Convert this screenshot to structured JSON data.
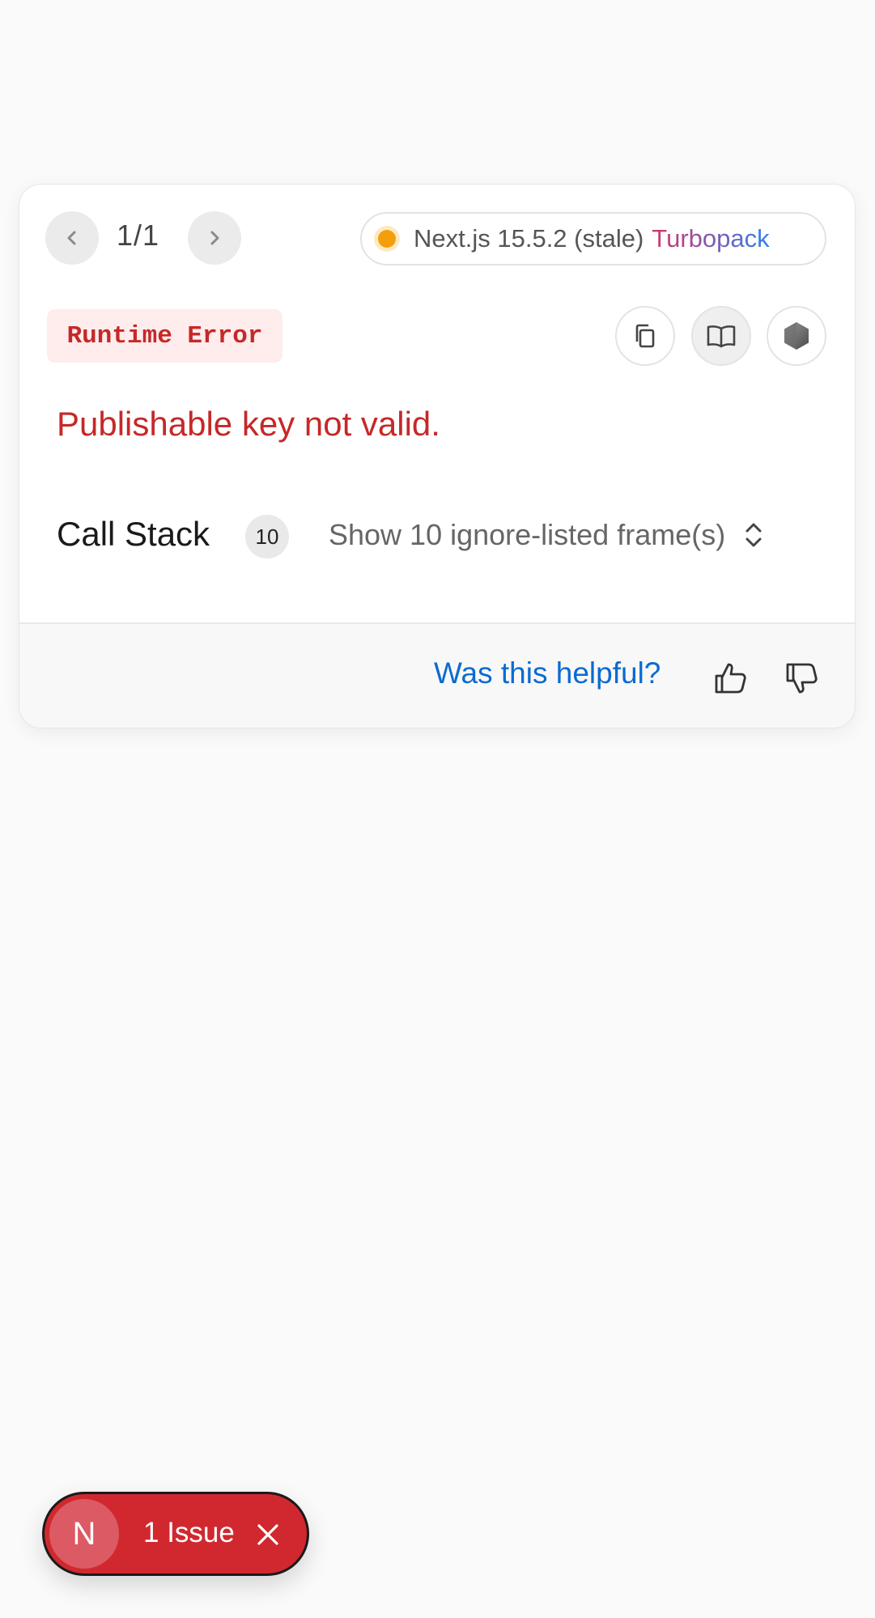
{
  "pager": {
    "text": "1/1"
  },
  "version": {
    "label": "Next.js 15.5.2 (stale)",
    "bundler": "Turbopack",
    "status_color": "#f59e0b"
  },
  "error": {
    "badge": "Runtime Error",
    "message": "Publishable key not valid."
  },
  "call_stack": {
    "title": "Call Stack",
    "count": "10",
    "toggle_label": "Show 10 ignore-listed frame(s)"
  },
  "feedback": {
    "question": "Was this helpful?"
  },
  "issues": {
    "logo_letter": "N",
    "label": "1 Issue"
  },
  "icons": [
    "chevron-left-icon",
    "chevron-right-icon",
    "copy-icon",
    "book-icon",
    "node-icon",
    "chevron-updown-icon",
    "thumbs-up-icon",
    "thumbs-down-icon",
    "close-icon"
  ],
  "colors": {
    "error_red": "#c62828",
    "link_blue": "#0a6bd1",
    "pill_red": "#d1282f"
  }
}
